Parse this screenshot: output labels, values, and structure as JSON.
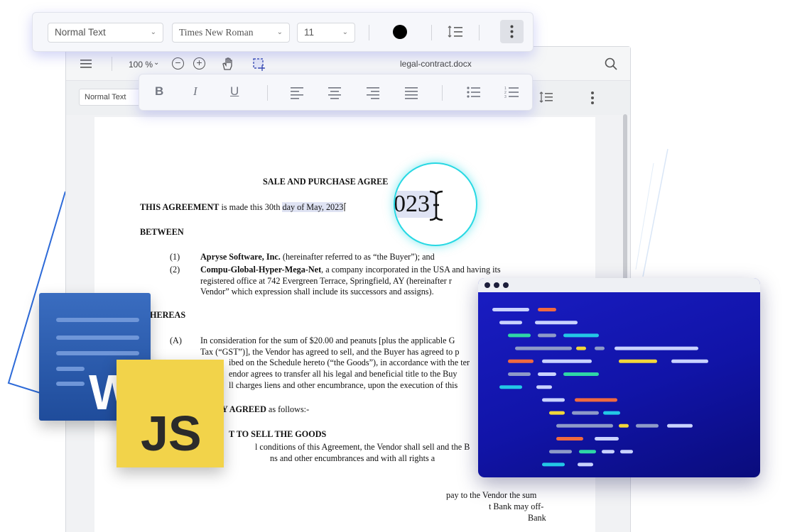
{
  "toolbar": {
    "paragraph_style": "Normal Text",
    "font_family": "Times New Roman",
    "font_size": "11",
    "text_color": "#000000"
  },
  "editor": {
    "zoom": "100 %",
    "filename": "legal-contract.docx",
    "mini_style": "Normal Text"
  },
  "document": {
    "title": "SALE AND PURCHASE AGREE",
    "line1_bold": "THIS AGREEMENT",
    "line1_a": " is made this 30th ",
    "line1_hl": "day of May, 2023",
    "between": "BETWEEN",
    "p1_num": "(1)",
    "p1_bold": "Apryse Software, Inc.",
    "p1_rest": " (hereinafter referred to as “the Buyer”); and",
    "p2_num": "(2)",
    "p2_bold": "Compu-Global-Hyper-Mega-Net",
    "p2_rest": ", a company incorporated in the USA and having its",
    "p2_l2": "registered office at 742 Evergreen Terrace, Springfield, AY (hereinafter r",
    "p2_l3": "Vendor” which expression shall include its successors and assigns).",
    "whereas": "HEREAS",
    "a_num": "(A)",
    "a_l1": "In consideration for the sum of $20.00 and peanuts [plus the applicable G",
    "a_l2": "Tax (“GST”)], the Vendor has agreed to sell, and the Buyer has agreed to p",
    "a_l3": "ibed on the Schedule hereto (“the Goods”), in accordance with the ter",
    "a_l4": "endor agrees to transfer all his legal and beneficial title to the Buy",
    "a_l5": "ll charges liens and other encumbrance, upon the execution of this",
    "agreed_bold": "Y AGREED",
    "agreed_rest": " as follows:-",
    "sell_heading": "T TO SELL THE GOODS",
    "s_l1": "l conditions of this Agreement, the Vendor shall sell and the B",
    "s_l2": "ns and other encumbrances and with all rights a",
    "s_l3": "pay to the Vendor the sum",
    "s_l4": "t Bank may off-",
    "s_l5": "Bank"
  },
  "magnifier": {
    "text": "023"
  },
  "word_tile": {
    "letter": "W"
  },
  "js_tile": {
    "letter": "JS"
  },
  "code_window": {
    "colors": {
      "white": "#c9d2ff",
      "orange": "#f06a3f",
      "teal": "#2fd6a6",
      "cyan": "#23c8e6",
      "yellow": "#f2d63a",
      "gray": "#8e9ac8"
    }
  }
}
